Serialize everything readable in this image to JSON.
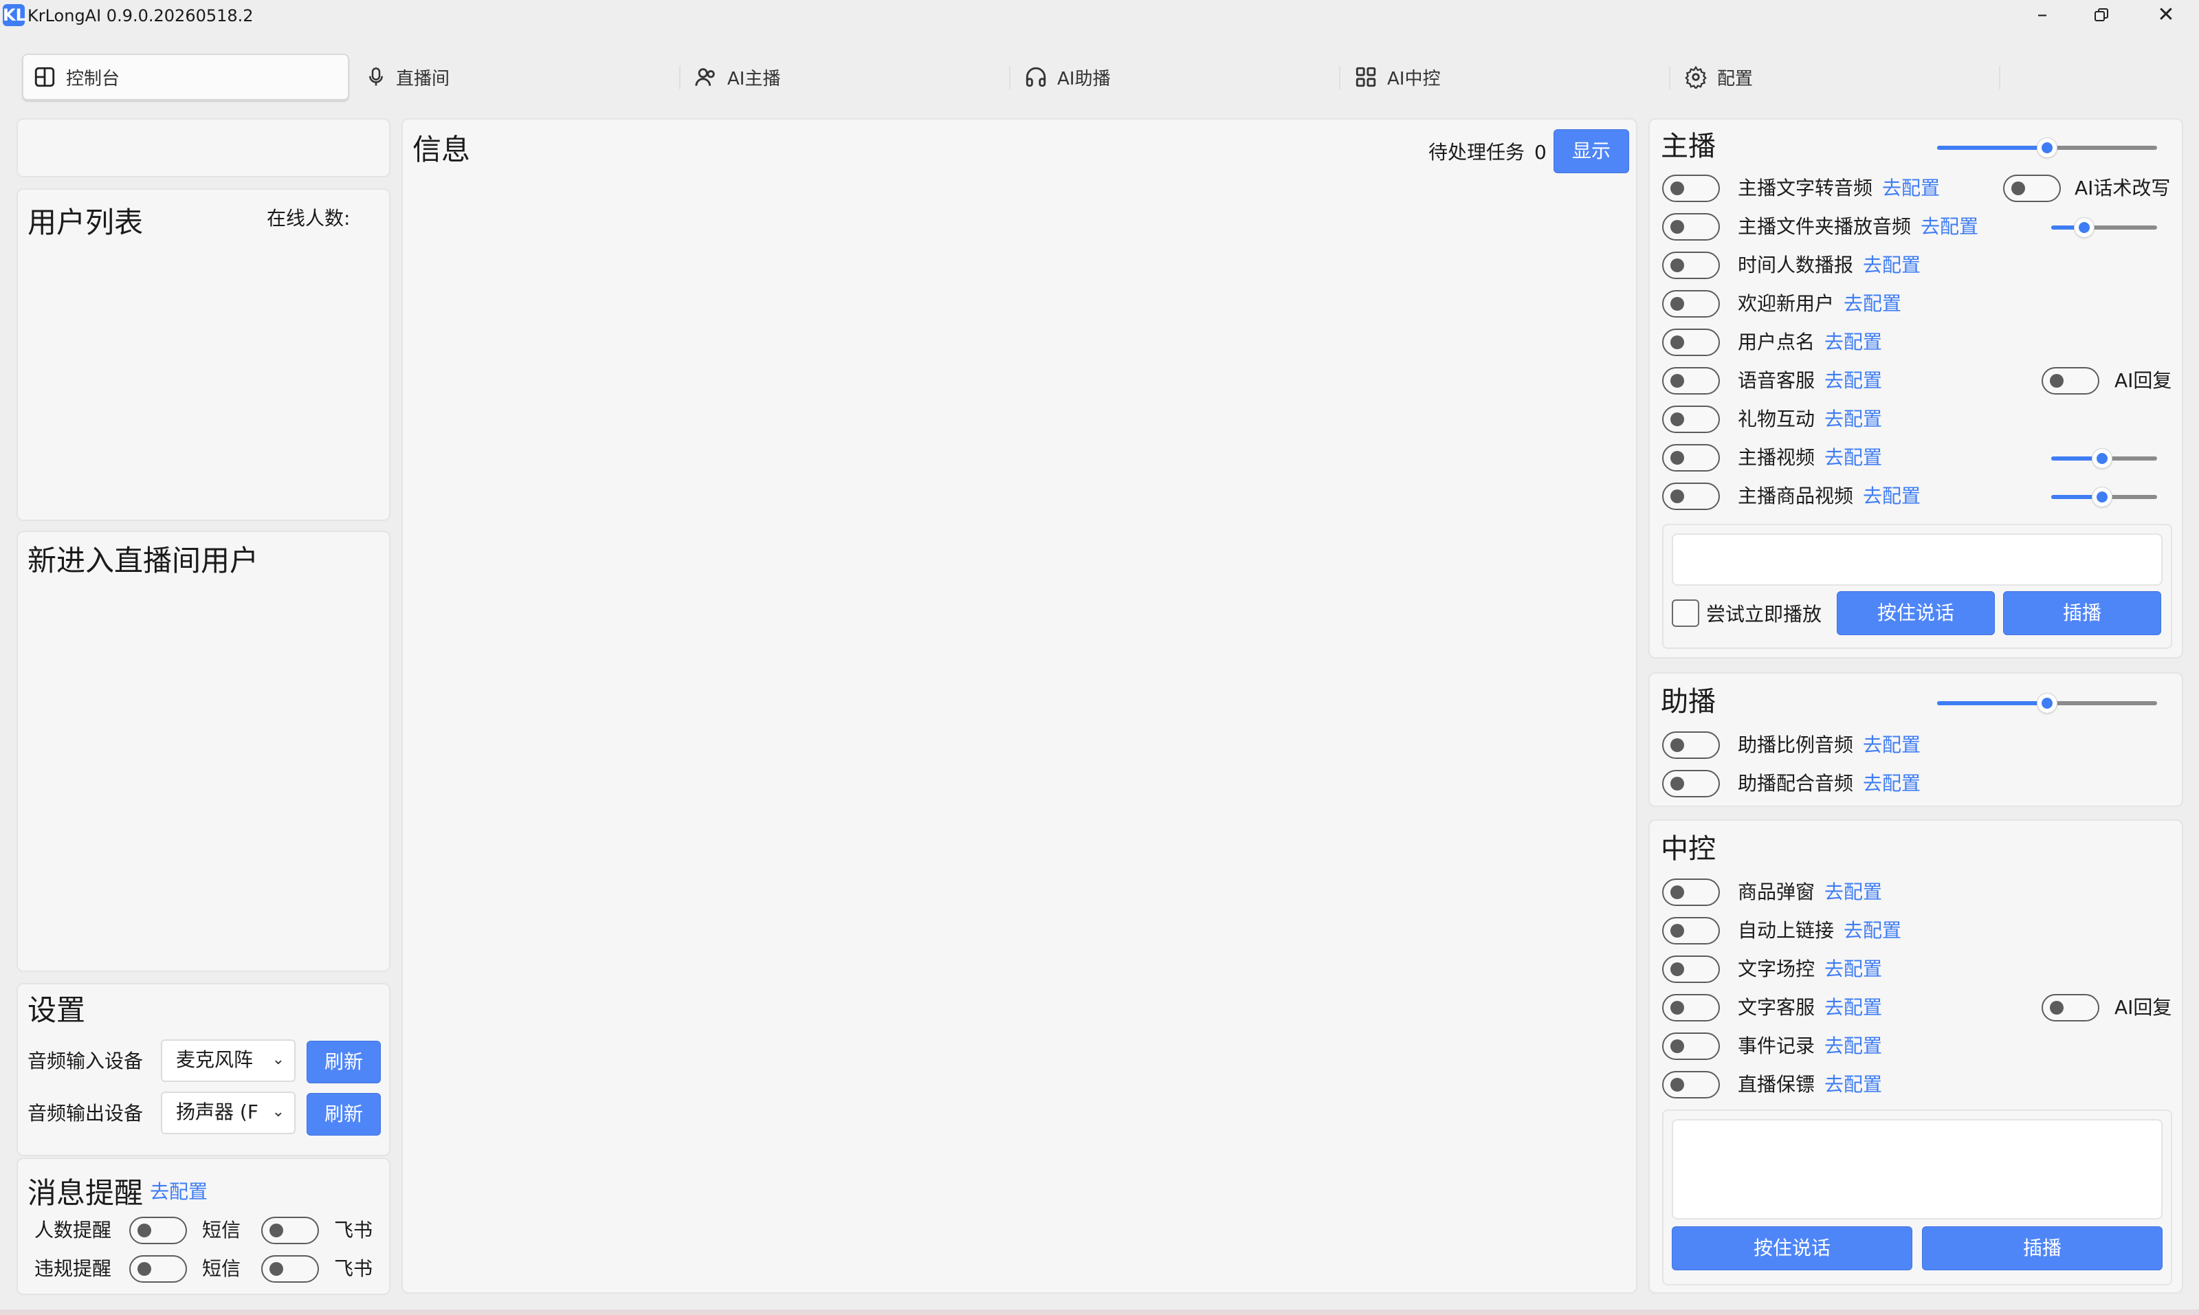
{
  "window": {
    "title": "KrLongAI 0.9.0.20260518.2",
    "logo": "KL"
  },
  "tabs": [
    {
      "label": "控制台",
      "icon": "dashboard-icon"
    },
    {
      "label": "直播间",
      "icon": "microphone-icon"
    },
    {
      "label": "AI主播",
      "icon": "users-icon"
    },
    {
      "label": "AI助播",
      "icon": "headphones-icon"
    },
    {
      "label": "AI中控",
      "icon": "grid-icon"
    },
    {
      "label": "配置",
      "icon": "gear-icon"
    }
  ],
  "left": {
    "user_list": {
      "title": "用户列表",
      "online_label": "在线人数:"
    },
    "new_users": {
      "title": "新进入直播间用户"
    },
    "settings": {
      "title": "设置",
      "input_label": "音频输入设备",
      "input_value": "麦克风阵",
      "output_label": "音频输出设备",
      "output_value": "扬声器 (F",
      "refresh": "刷新"
    },
    "alerts": {
      "title": "消息提醒",
      "config_link": "去配置",
      "rows": [
        {
          "label": "人数提醒",
          "sms": "短信",
          "feishu": "飞书"
        },
        {
          "label": "违规提醒",
          "sms": "短信",
          "feishu": "飞书"
        }
      ]
    }
  },
  "info": {
    "title": "信息",
    "pending_label": "待处理任务",
    "pending_count": "0",
    "show_button": "显示"
  },
  "anchor": {
    "title": "主播",
    "config_link": "去配置",
    "items": [
      {
        "label": "主播文字转音频"
      },
      {
        "label": "主播文件夹播放音频"
      },
      {
        "label": "时间人数播报"
      },
      {
        "label": "欢迎新用户"
      },
      {
        "label": "用户点名"
      },
      {
        "label": "语音客服"
      },
      {
        "label": "礼物互动"
      },
      {
        "label": "主播视频"
      },
      {
        "label": "主播商品视频"
      }
    ],
    "ai_rewrite": "AI话术改写",
    "ai_reply": "AI回复",
    "try_play": "尝试立即播放",
    "hold_talk": "按住说话",
    "insert": "插播",
    "volume": 0.5
  },
  "assistant": {
    "title": "助播",
    "items": [
      {
        "label": "助播比例音频"
      },
      {
        "label": "助播配合音频"
      }
    ],
    "volume": 0.5
  },
  "control": {
    "title": "中控",
    "items": [
      {
        "label": "商品弹窗"
      },
      {
        "label": "自动上链接"
      },
      {
        "label": "文字场控"
      },
      {
        "label": "文字客服"
      },
      {
        "label": "事件记录"
      },
      {
        "label": "直播保镖"
      }
    ],
    "ai_reply": "AI回复",
    "hold_talk": "按住说话",
    "insert": "插播"
  }
}
